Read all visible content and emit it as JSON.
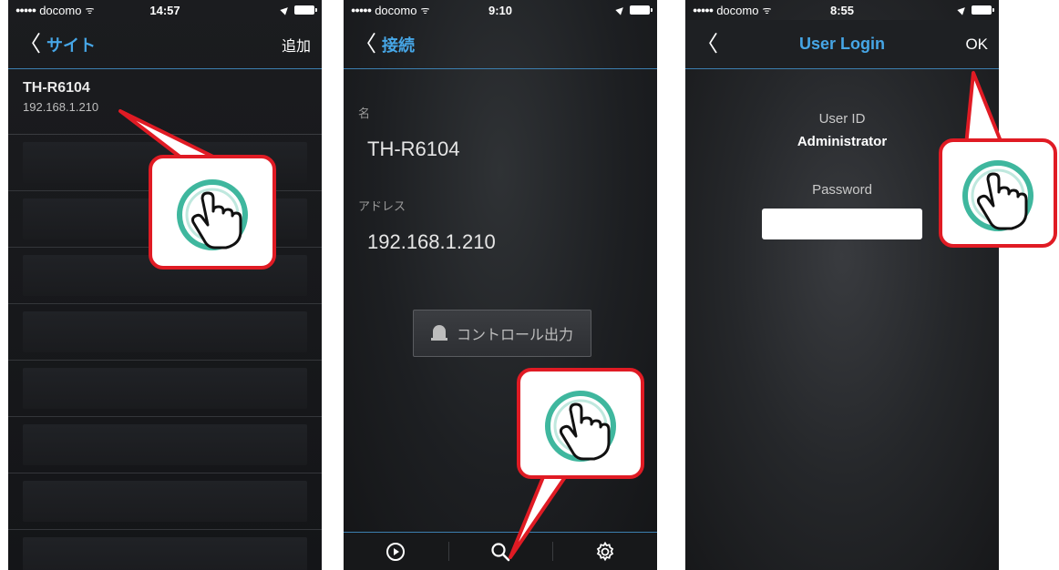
{
  "screen1": {
    "status": {
      "carrier": "docomo",
      "time": "14:57"
    },
    "nav": {
      "title": "サイト",
      "action": "追加"
    },
    "site": {
      "name": "TH-R6104",
      "address": "192.168.1.210"
    }
  },
  "screen2": {
    "status": {
      "carrier": "docomo",
      "time": "9:10"
    },
    "nav": {
      "title": "接続"
    },
    "name_label": "名",
    "name_value": "TH-R6104",
    "address_label": "アドレス",
    "address_value": "192.168.1.210",
    "control_button": "コントロール出力",
    "tabs": [
      "play-icon",
      "search-icon",
      "gear-icon"
    ]
  },
  "screen3": {
    "status": {
      "carrier": "docomo",
      "time": "8:55"
    },
    "nav": {
      "title": "User Login",
      "action": "OK"
    },
    "userid_label": "User ID",
    "userid_value": "Administrator",
    "password_label": "Password",
    "password_value": ""
  },
  "colors": {
    "accent": "#46a6e6",
    "callout_border": "#e01b24",
    "hand_ring": "#3fb79e"
  }
}
